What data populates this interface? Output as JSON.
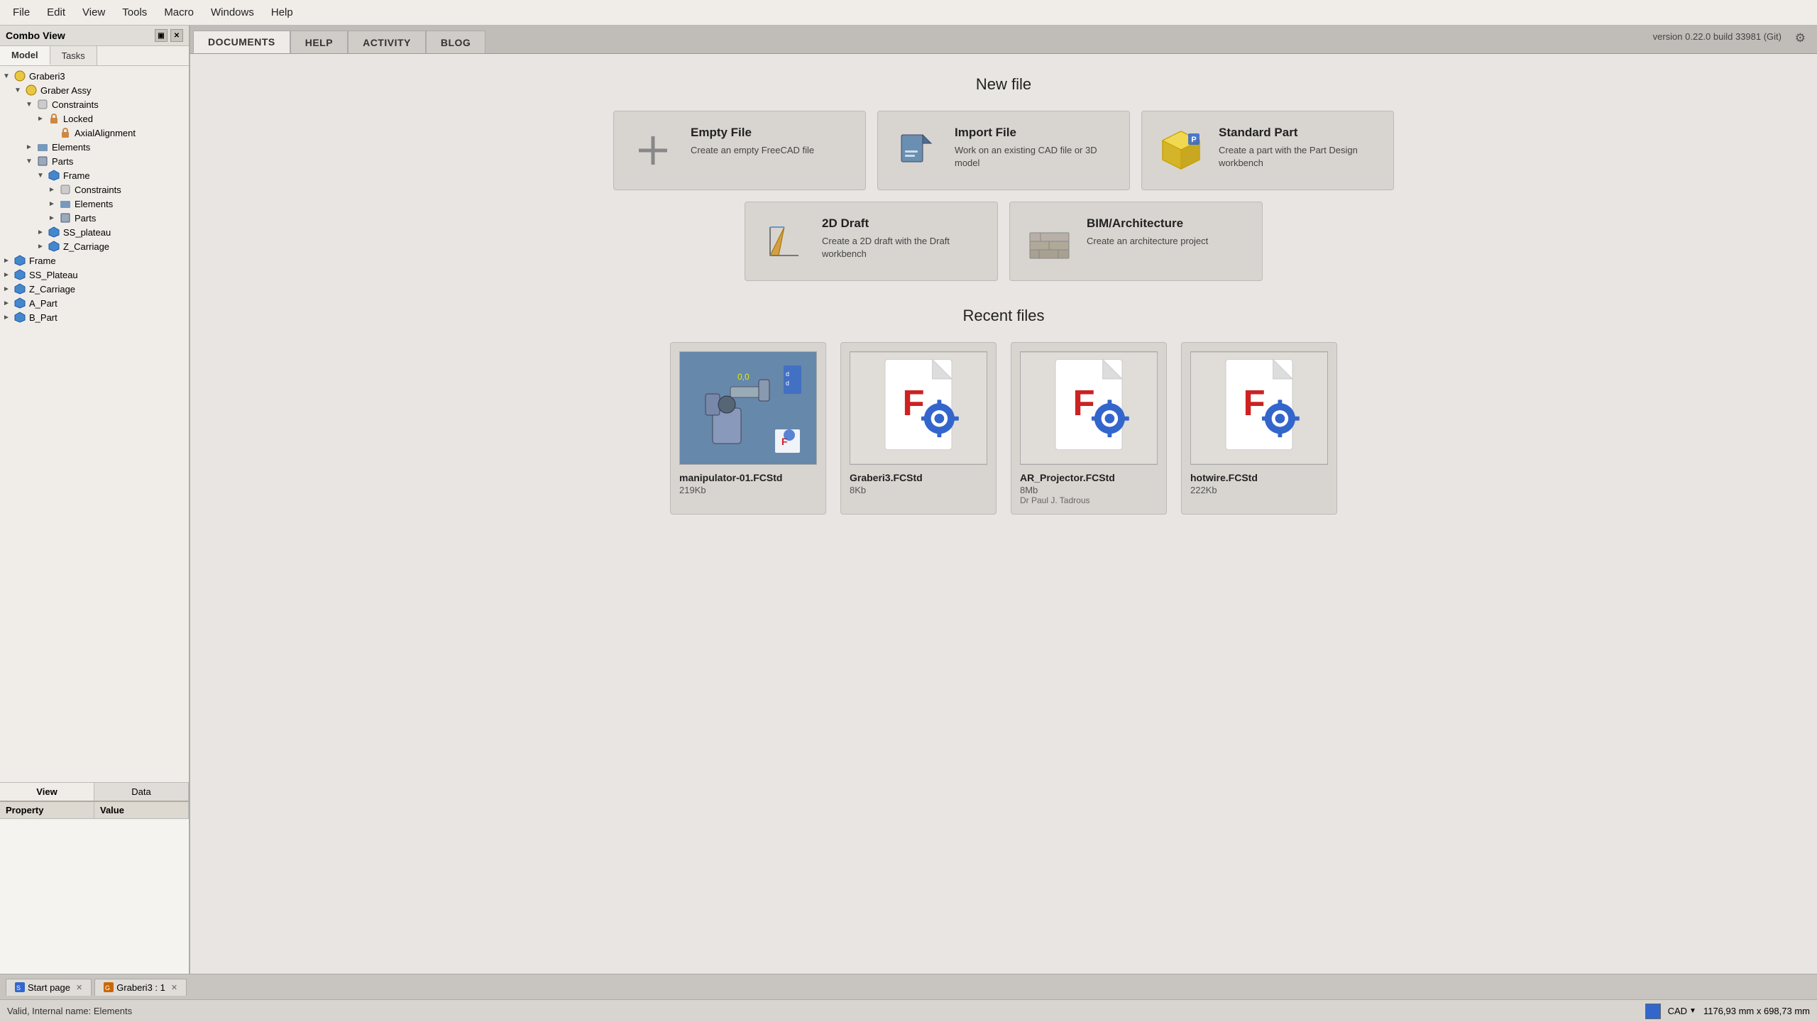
{
  "menubar": {
    "items": [
      "File",
      "Edit",
      "View",
      "Tools",
      "Macro",
      "Windows",
      "Help"
    ]
  },
  "left_panel": {
    "title": "Combo View",
    "tabs": [
      "Model",
      "Tasks"
    ],
    "active_tab": "Model",
    "tree": [
      {
        "id": "graberi3",
        "label": "Graberi3",
        "level": 0,
        "icon": "assy",
        "expanded": true,
        "arrow": "▼"
      },
      {
        "id": "graber-assy",
        "label": "Graber Assy",
        "level": 1,
        "icon": "assy",
        "expanded": true,
        "arrow": "▼"
      },
      {
        "id": "constraints",
        "label": "Constraints",
        "level": 2,
        "icon": "constraints",
        "expanded": true,
        "arrow": "▼"
      },
      {
        "id": "locked",
        "label": "Locked",
        "level": 3,
        "icon": "locked",
        "expanded": false,
        "arrow": "►"
      },
      {
        "id": "axial-alignment",
        "label": "AxialAlignment",
        "level": 4,
        "icon": "locked",
        "expanded": false,
        "arrow": ""
      },
      {
        "id": "elements",
        "label": "Elements",
        "level": 2,
        "icon": "elements",
        "expanded": false,
        "arrow": "►"
      },
      {
        "id": "parts",
        "label": "Parts",
        "level": 2,
        "icon": "parts",
        "expanded": true,
        "arrow": "▼"
      },
      {
        "id": "frame",
        "label": "Frame",
        "level": 3,
        "icon": "frame",
        "expanded": true,
        "arrow": "▼"
      },
      {
        "id": "frame-constraints",
        "label": "Constraints",
        "level": 4,
        "icon": "constraints",
        "expanded": false,
        "arrow": "►"
      },
      {
        "id": "frame-elements",
        "label": "Elements",
        "level": 4,
        "icon": "elements",
        "expanded": false,
        "arrow": "►"
      },
      {
        "id": "frame-parts",
        "label": "Parts",
        "level": 4,
        "icon": "parts",
        "expanded": false,
        "arrow": "►"
      },
      {
        "id": "ss-plateau",
        "label": "SS_plateau",
        "level": 3,
        "icon": "part-blue",
        "expanded": false,
        "arrow": "►"
      },
      {
        "id": "z-carriage",
        "label": "Z_Carriage",
        "level": 3,
        "icon": "part-blue",
        "expanded": false,
        "arrow": "►"
      },
      {
        "id": "frame-root",
        "label": "Frame",
        "level": 0,
        "icon": "part-blue",
        "expanded": false,
        "arrow": "►"
      },
      {
        "id": "ss-plateau-root",
        "label": "SS_Plateau",
        "level": 0,
        "icon": "part-blue",
        "expanded": false,
        "arrow": "►"
      },
      {
        "id": "z-carriage-root",
        "label": "Z_Carriage",
        "level": 0,
        "icon": "part-blue",
        "expanded": false,
        "arrow": "►"
      },
      {
        "id": "a-part",
        "label": "A_Part",
        "level": 0,
        "icon": "part-blue",
        "expanded": false,
        "arrow": "►"
      },
      {
        "id": "b-part",
        "label": "B_Part",
        "level": 0,
        "icon": "part-blue",
        "expanded": false,
        "arrow": "►"
      }
    ],
    "property_cols": [
      "Property",
      "Value"
    ],
    "view_data_tabs": [
      "View",
      "Data"
    ],
    "active_vd_tab": "View"
  },
  "content_tabs": [
    "DOCUMENTS",
    "HELP",
    "ACTIVITY",
    "BLOG"
  ],
  "active_content_tab": "DOCUMENTS",
  "version_label": "version 0.22.0 build 33981 (Git)",
  "start_page": {
    "new_file_title": "New file",
    "new_file_cards": [
      {
        "id": "empty-file",
        "title": "Empty File",
        "description": "Create an empty FreeCAD file",
        "icon_type": "plus"
      },
      {
        "id": "import-file",
        "title": "Import File",
        "description": "Work on an existing CAD file or 3D model",
        "icon_type": "import"
      },
      {
        "id": "standard-part",
        "title": "Standard Part",
        "description": "Create a part with the Part Design workbench",
        "icon_type": "standard-part"
      }
    ],
    "second_row_cards": [
      {
        "id": "2d-draft",
        "title": "2D Draft",
        "description": "Create a 2D draft with the Draft workbench",
        "icon_type": "draft"
      },
      {
        "id": "bim-architecture",
        "title": "BIM/Architecture",
        "description": "Create an architecture project",
        "icon_type": "bim"
      }
    ],
    "recent_files_title": "Recent files",
    "recent_files": [
      {
        "id": "manipulator",
        "name": "manipulator-01.FCStd",
        "size": "219Kb",
        "author": "",
        "thumb_type": "manipulator"
      },
      {
        "id": "graberi3",
        "name": "Graberi3.FCStd",
        "size": "8Kb",
        "author": "",
        "thumb_type": "freecad"
      },
      {
        "id": "ar-projector",
        "name": "AR_Projector.FCStd",
        "size": "8Mb",
        "author": "Dr Paul J. Tadrous",
        "thumb_type": "freecad"
      },
      {
        "id": "hotwire",
        "name": "hotwire.FCStd",
        "size": "222Kb",
        "author": "",
        "thumb_type": "freecad"
      }
    ]
  },
  "page_tabs": [
    {
      "id": "start-page",
      "label": "Start page",
      "closable": true
    },
    {
      "id": "graberi3-tab",
      "label": "Graberi3 : 1",
      "closable": true
    }
  ],
  "status_bar": {
    "status_text": "Valid, Internal name: Elements",
    "cad_label": "CAD",
    "coords": "1176,93 mm x 698,73 mm"
  },
  "icons": {
    "settings": "⚙",
    "close": "✕",
    "arrow_right": "►",
    "arrow_down": "▼",
    "tree_dot": "●"
  }
}
